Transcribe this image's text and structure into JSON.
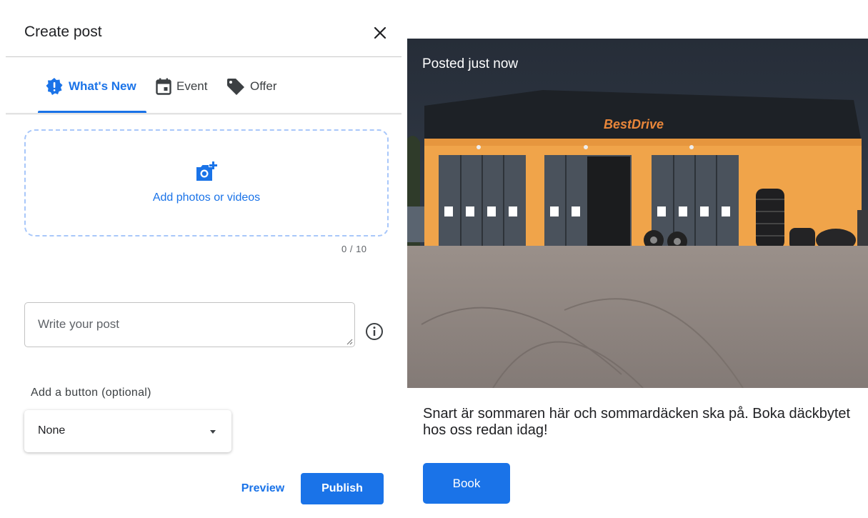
{
  "dialog": {
    "title": "Create post",
    "tabs": [
      {
        "label": "What's New",
        "active": true
      },
      {
        "label": "Event",
        "active": false
      },
      {
        "label": "Offer",
        "active": false
      }
    ],
    "upload": {
      "label": "Add photos or videos",
      "counter": "0 / 10"
    },
    "post_input": {
      "placeholder": "Write your post"
    },
    "button_section": {
      "label": "Add a button (optional)",
      "selected": "None"
    },
    "actions": {
      "preview_label": "Preview",
      "publish_label": "Publish"
    }
  },
  "post_preview": {
    "status": "Posted just now",
    "photo": {
      "sign_text": "BestDrive"
    },
    "caption": "Snart är sommaren här och sommardäcken ska på. Boka däckbytet hos oss redan idag!",
    "cta_label": "Book"
  },
  "colors": {
    "accent": "#1a73e8",
    "building": "#f0a44a",
    "sky": "#2b3340",
    "asphalt": "#8d8580"
  },
  "icons": {
    "close": "close-icon",
    "whats_new": "announcement-badge-icon",
    "event": "calendar-icon",
    "offer": "tag-icon",
    "upload": "add-photo-icon",
    "info": "info-icon",
    "dropdown": "caret-down-icon"
  }
}
